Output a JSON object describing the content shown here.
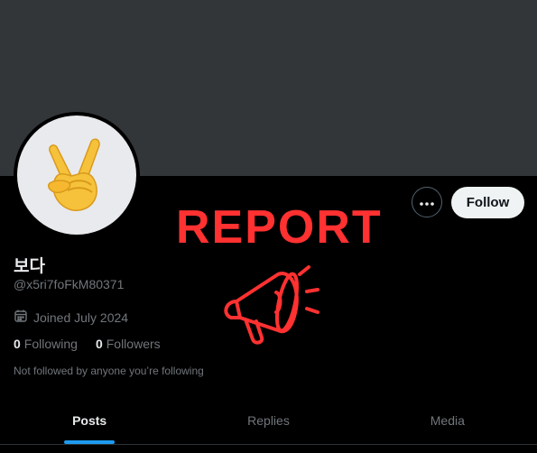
{
  "profile": {
    "display_name": "보다",
    "handle": "@x5ri7foFkM80371",
    "joined": "Joined July 2024",
    "following_count": "0",
    "following_label": "Following",
    "followers_count": "0",
    "followers_label": "Followers",
    "not_followed_text": "Not followed by anyone you’re following",
    "avatar_icon": "victory-hand-icon"
  },
  "actions": {
    "follow_label": "Follow",
    "more_icon": "more-dots-icon"
  },
  "overlay": {
    "report_text": "REPORT",
    "megaphone_icon": "megaphone-icon",
    "color": "#ff3131"
  },
  "tabs": [
    {
      "label": "Posts",
      "active": true
    },
    {
      "label": "Replies",
      "active": false
    },
    {
      "label": "Media",
      "active": false
    }
  ],
  "colors": {
    "banner": "#333639",
    "background": "#000000",
    "accent": "#1d9bf0",
    "secondary_text": "#71767b"
  }
}
